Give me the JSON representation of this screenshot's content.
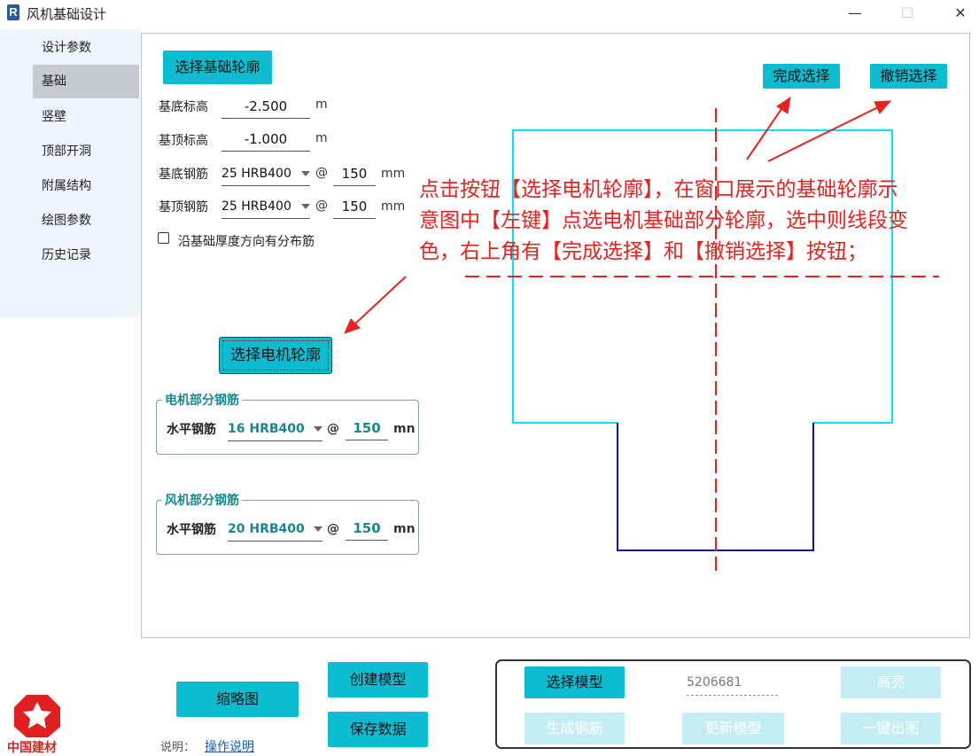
{
  "window": {
    "title": "风机基础设计",
    "icon_letter": "R",
    "minimize": "—",
    "maximize": "☐",
    "close": "✕"
  },
  "sidebar": {
    "items": [
      {
        "label": "设计参数"
      },
      {
        "label": "基础"
      },
      {
        "label": "竖壁"
      },
      {
        "label": "顶部开洞"
      },
      {
        "label": "附属结构"
      },
      {
        "label": "绘图参数"
      },
      {
        "label": "历史记录"
      }
    ],
    "active_index": 1
  },
  "main": {
    "select_foundation_btn": "选择基础轮廓",
    "bottom_elev": {
      "label": "基底标高",
      "value": "-2.500",
      "unit": "m"
    },
    "top_elev": {
      "label": "基顶标高",
      "value": "-1.000",
      "unit": "m"
    },
    "bottom_rebar": {
      "label": "基底钢筋",
      "value": "25 HRB400",
      "at": "@",
      "spacing": "150",
      "unit": "mm"
    },
    "top_rebar": {
      "label": "基顶钢筋",
      "value": "25 HRB400",
      "at": "@",
      "spacing": "150",
      "unit": "mm"
    },
    "dist_rebar_checkbox": {
      "label": "沿基础厚度方向有分布筋",
      "checked": false
    },
    "select_motor_btn": "选择电机轮廓",
    "motor_group": {
      "title": "电机部分钢筋",
      "label": "水平钢筋",
      "value": "16 HRB400",
      "at": "@",
      "spacing": "150",
      "unit": "mn"
    },
    "fan_group": {
      "title": "风机部分钢筋",
      "label": "水平钢筋",
      "value": "20 HRB400",
      "at": "@",
      "spacing": "150",
      "unit": "mn"
    },
    "finish_select_btn": "完成选择",
    "cancel_select_btn": "撤销选择",
    "annotation": [
      "点击按钮【选择电机轮廓】，在窗口展示的基础轮廓示",
      "意图中【左键】点选电机基础部分轮廓，选中则线段变",
      "色，右上角有【完成选择】和【撤销选择】按钮；"
    ],
    "colors": {
      "outline_cyan": "#00e5ff",
      "outline_selected": "#1010b0",
      "annotation_red": "#e8231f",
      "accent": "#0cbcd0"
    }
  },
  "bottom": {
    "thumbnail_btn": "缩略图",
    "create_model_btn": "创建模型",
    "save_data_btn": "保存数据",
    "note_label": "说明：",
    "note_link": "操作说明",
    "logo_text": "中国建材",
    "select_model_btn": "选择模型",
    "model_id": "5206681",
    "highlight_btn": "高亮",
    "gen_rebar_btn": "生成钢筋",
    "update_model_btn": "更新模型",
    "one_click_btn": "一键出图"
  }
}
